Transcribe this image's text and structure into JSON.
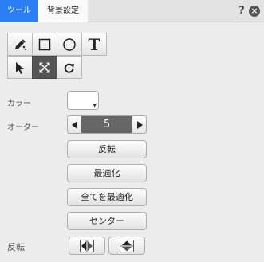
{
  "tabs": [
    {
      "label": "ツール",
      "active": true
    },
    {
      "label": "背景設定",
      "active": false
    }
  ],
  "window_controls": {
    "help_label": "?",
    "close_label": "×"
  },
  "tools": [
    {
      "name": "pen",
      "icon": "pen-icon",
      "active": false
    },
    {
      "name": "rectangle",
      "icon": "rectangle-icon",
      "active": false
    },
    {
      "name": "ellipse",
      "icon": "ellipse-icon",
      "active": false
    },
    {
      "name": "text",
      "icon": "text-icon",
      "label": "T",
      "active": false
    },
    {
      "name": "select",
      "icon": "arrow-pointer-icon",
      "active": false
    },
    {
      "name": "transform",
      "icon": "expand-arrows-icon",
      "active": true
    },
    {
      "name": "rotate",
      "icon": "rotate-icon",
      "active": false
    }
  ],
  "form": {
    "color_label": "カラー",
    "color_value": "#ffffff",
    "order_label": "オーダー",
    "order_value": "5",
    "flip_label": "反転"
  },
  "buttons": {
    "flip": "反転",
    "optimize": "最適化",
    "optimize_all": "全てを最適化",
    "center": "センター"
  },
  "colors": {
    "accent": "#2a7ff5",
    "active_tool": "#555555",
    "panel_bg": "#ececec"
  }
}
